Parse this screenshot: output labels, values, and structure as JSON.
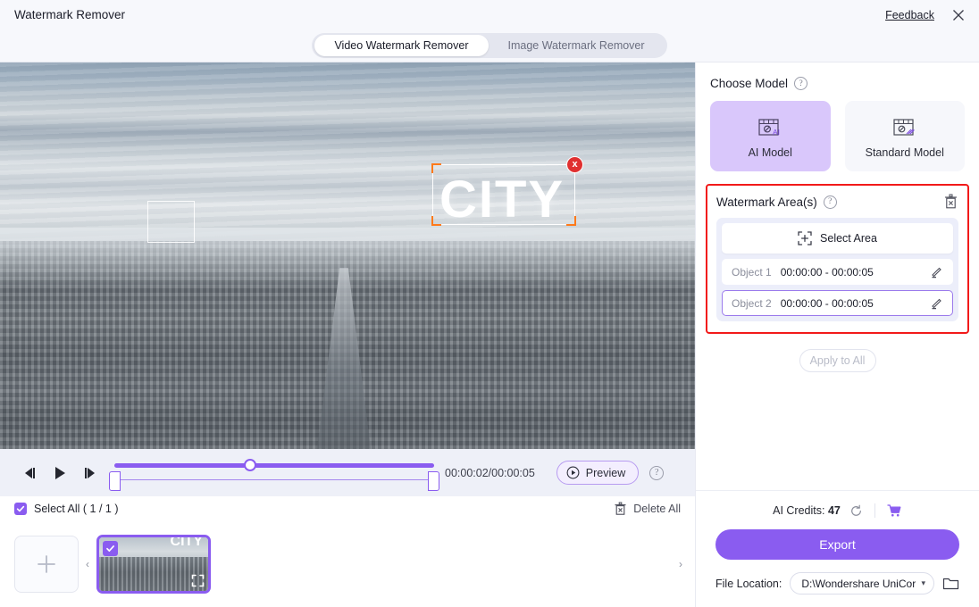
{
  "titlebar": {
    "app_title": "Watermark Remover",
    "feedback_label": "Feedback",
    "close_icon": "close-icon"
  },
  "tabs": [
    {
      "label": "Video Watermark Remover",
      "active": true
    },
    {
      "label": "Image Watermark Remover",
      "active": false
    }
  ],
  "stage": {
    "watermark_text": "CITY",
    "selection_close_icon": "x"
  },
  "player": {
    "prev_frame_icon": "step-backward-icon",
    "play_icon": "play-icon",
    "next_frame_icon": "step-forward-icon",
    "time_display": "00:00:02/00:00:05",
    "preview_label": "Preview",
    "help_glyph": "?",
    "progress_percent": 45
  },
  "filmstrip": {
    "select_all_label": "Select All ( 1 / 1 )",
    "delete_all_label": "Delete All",
    "add_icon": "plus-icon",
    "prev_arrow": "‹",
    "next_arrow": "›",
    "thumb_watermark_text": "CITY"
  },
  "right_panel": {
    "choose_model_title": "Choose Model",
    "help_glyph": "?",
    "models": [
      {
        "label": "AI Model",
        "active": true,
        "icon": "ai-model-icon"
      },
      {
        "label": "Standard Model",
        "active": false,
        "icon": "standard-model-icon"
      }
    ],
    "watermark_areas": {
      "title": "Watermark Area(s)",
      "trash_icon": "delete-icon",
      "select_area_label": "Select Area",
      "select_area_icon": "crosshair-select-icon",
      "objects": [
        {
          "name": "Object 1",
          "time_range": "00:00:00 - 00:00:05",
          "selected": false,
          "edit_icon": "pencil-icon"
        },
        {
          "name": "Object 2",
          "time_range": "00:00:00 - 00:00:05",
          "selected": true,
          "edit_icon": "pencil-icon"
        }
      ]
    },
    "apply_to_all_label": "Apply to All",
    "credits_label": "AI Credits:",
    "credits_value": "47",
    "refresh_icon": "refresh-icon",
    "cart_icon": "cart-icon",
    "export_label": "Export",
    "file_location_label": "File Location:",
    "file_location_value": "D:\\Wondershare UniCor",
    "caret_glyph": "▾",
    "folder_icon": "folder-icon"
  },
  "colors": {
    "accent": "#8a5cf0",
    "accent_light": "#d9c7fb",
    "highlight_red": "#f21a1a",
    "selection_orange": "#ff7a1a",
    "close_red": "#e03030"
  }
}
